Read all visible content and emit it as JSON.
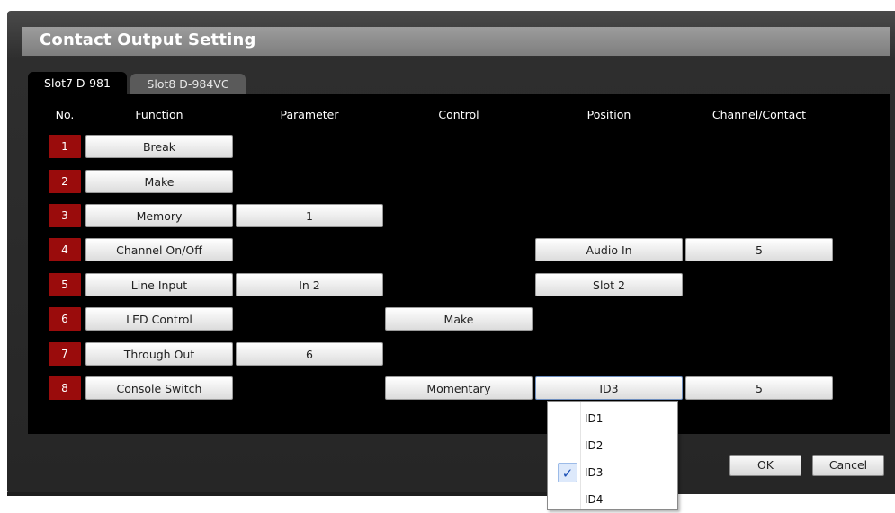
{
  "dialog": {
    "title": "Contact Output Setting",
    "tabs": [
      {
        "label": "Slot7  D-981",
        "active": true
      },
      {
        "label": "Slot8  D-984VC",
        "active": false
      }
    ],
    "columns": [
      "No.",
      "Function",
      "Parameter",
      "Control",
      "Position",
      "Channel/Contact"
    ],
    "rows": [
      {
        "no": "1",
        "function": "Break",
        "parameter": "",
        "control": "",
        "position": "",
        "channel": ""
      },
      {
        "no": "2",
        "function": "Make",
        "parameter": "",
        "control": "",
        "position": "",
        "channel": ""
      },
      {
        "no": "3",
        "function": "Memory",
        "parameter": "1",
        "control": "",
        "position": "",
        "channel": ""
      },
      {
        "no": "4",
        "function": "Channel On/Off",
        "parameter": "",
        "control": "",
        "position": "Audio In",
        "channel": "5"
      },
      {
        "no": "5",
        "function": "Line Input",
        "parameter": "In 2",
        "control": "",
        "position": "Slot 2",
        "channel": ""
      },
      {
        "no": "6",
        "function": "LED Control",
        "parameter": "",
        "control": "Make",
        "position": "",
        "channel": ""
      },
      {
        "no": "7",
        "function": "Through Out",
        "parameter": "6",
        "control": "",
        "position": "",
        "channel": ""
      },
      {
        "no": "8",
        "function": "Console Switch",
        "parameter": "",
        "control": "Momentary",
        "position": "ID3",
        "channel": "5"
      }
    ],
    "ok_label": "OK",
    "cancel_label": "Cancel",
    "dropdown": {
      "items": [
        {
          "label": "ID1",
          "checked": false
        },
        {
          "label": "ID2",
          "checked": false
        },
        {
          "label": "ID3",
          "checked": true
        },
        {
          "label": "ID4",
          "checked": false
        }
      ],
      "check_glyph": "✓"
    }
  },
  "colors": {
    "number_badge": "#9a0c0c",
    "panel": "#000000",
    "title_bar": "#8c8c8c",
    "check": "#1a4fb5"
  }
}
